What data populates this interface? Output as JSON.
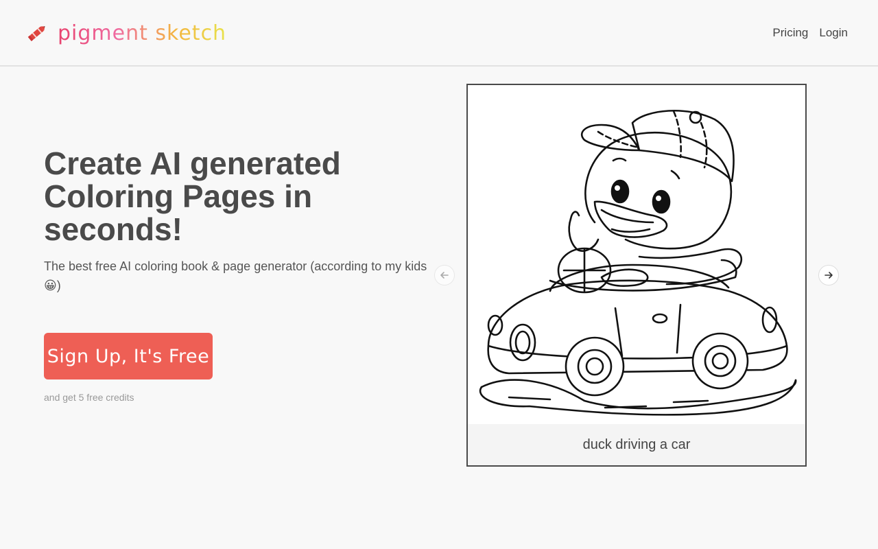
{
  "header": {
    "logo_text": "pigment sketch",
    "logo_icon": "crayon-icon",
    "nav": [
      {
        "label": "Pricing"
      },
      {
        "label": "Login"
      }
    ]
  },
  "hero": {
    "title": "Create AI generated Coloring Pages in seconds!",
    "subtitle": "The best free AI coloring book & page generator (according to my kids",
    "subtitle_emoji": "😀",
    "subtitle_end": ")",
    "cta_label": "Sign Up, It's Free",
    "cta_note": "and get 5 free credits"
  },
  "carousel": {
    "prev_icon": "arrow-left-icon",
    "next_icon": "arrow-right-icon",
    "current_caption": "duck driving a car"
  },
  "colors": {
    "accent": "#ee5f55",
    "logo_gradient": [
      "#e8426e",
      "#ef6aa0",
      "#f3b640",
      "#e8e24a"
    ],
    "text": "#4a4a4a"
  }
}
